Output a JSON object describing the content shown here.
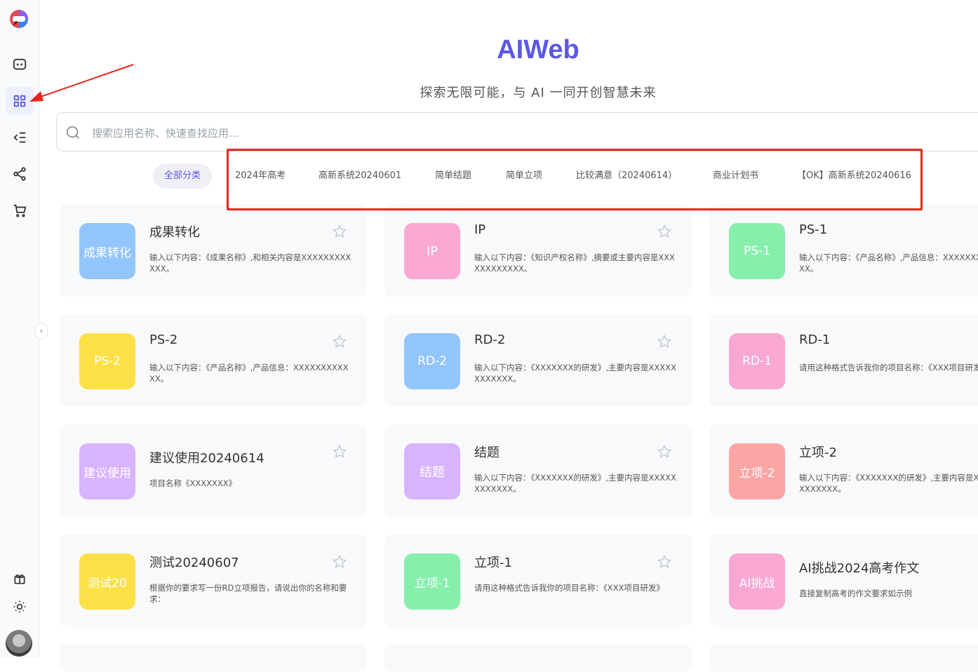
{
  "header": {
    "title": "AIWeb",
    "subtitle": "探索无限可能，与 AI 一同开创智慧未来"
  },
  "search": {
    "placeholder": "搜索应用名称、快速查找应用..."
  },
  "sidebar": {
    "items": [
      {
        "icon": "chat-icon"
      },
      {
        "icon": "grid-apps-icon",
        "active": true
      },
      {
        "icon": "list-indent-icon"
      },
      {
        "icon": "share-icon"
      },
      {
        "icon": "cart-icon"
      }
    ],
    "bottom": [
      {
        "icon": "gift-icon"
      },
      {
        "icon": "sun-icon"
      }
    ]
  },
  "tabs": [
    "全部分类",
    "2024年高考",
    "高新系统20240601",
    "简单结题",
    "简单立项",
    "比较满意（20240614）",
    "商业计划书",
    "【OK】高新系统20240616"
  ],
  "cards": [
    {
      "badge": "成果转化",
      "color": "#93c5fd",
      "name": "成果转化",
      "desc": "输入以下内容：《成果名称》,和相关内容是XXXXXXXXXXXX。"
    },
    {
      "badge": "IP",
      "color": "#f9a8d4",
      "name": "IP",
      "desc": "输入以下内容：《知识产权名称》,摘要或主要内容是XXXXXXXXXXXX。"
    },
    {
      "badge": "PS-1",
      "color": "#86efac",
      "name": "PS-1",
      "desc": "输入以下内容：《产品名称》,产品信息：XXXXXXXXXXXX。"
    },
    {
      "badge": "PS-2",
      "color": "#fde047",
      "name": "PS-2",
      "desc": "输入以下内容：《产品名称》,产品信息：XXXXXXXXXXXX。"
    },
    {
      "badge": "RD-2",
      "color": "#93c5fd",
      "name": "RD-2",
      "desc": "输入以下内容：《XXXXXXX的研发》,主要内容是XXXXXXXXXXXX。"
    },
    {
      "badge": "RD-1",
      "color": "#f9a8d4",
      "name": "RD-1",
      "desc": "请用这种格式告诉我你的项目名称：《XXX项目研发》"
    },
    {
      "badge": "建议使用",
      "color": "#d8b4fe",
      "name": "建议使用20240614",
      "desc": "项目名称《XXXXXXX》"
    },
    {
      "badge": "结题",
      "color": "#d8b4fe",
      "name": "结题",
      "desc": "输入以下内容：《XXXXXXX的研发》,主要内容是XXXXXXXXXXXX。"
    },
    {
      "badge": "立项-2",
      "color": "#fca5a5",
      "name": "立项-2",
      "desc": "输入以下内容：《XXXXXXX的研发》,主要内容是XXXXXXXXXXXX。"
    },
    {
      "badge": "测试20",
      "color": "#fde047",
      "name": "测试20240607",
      "desc": "根据你的要求写一份RD立项报告，请说出你的名称和要求："
    },
    {
      "badge": "立项-1",
      "color": "#86efac",
      "name": "立项-1",
      "desc": "请用这种格式告诉我你的项目名称：《XXX项目研发》"
    },
    {
      "badge": "AI挑战",
      "color": "#f9a8d4",
      "name": "AI挑战2024高考作文",
      "desc": "直接复制高考的作文要求如示例"
    }
  ]
}
